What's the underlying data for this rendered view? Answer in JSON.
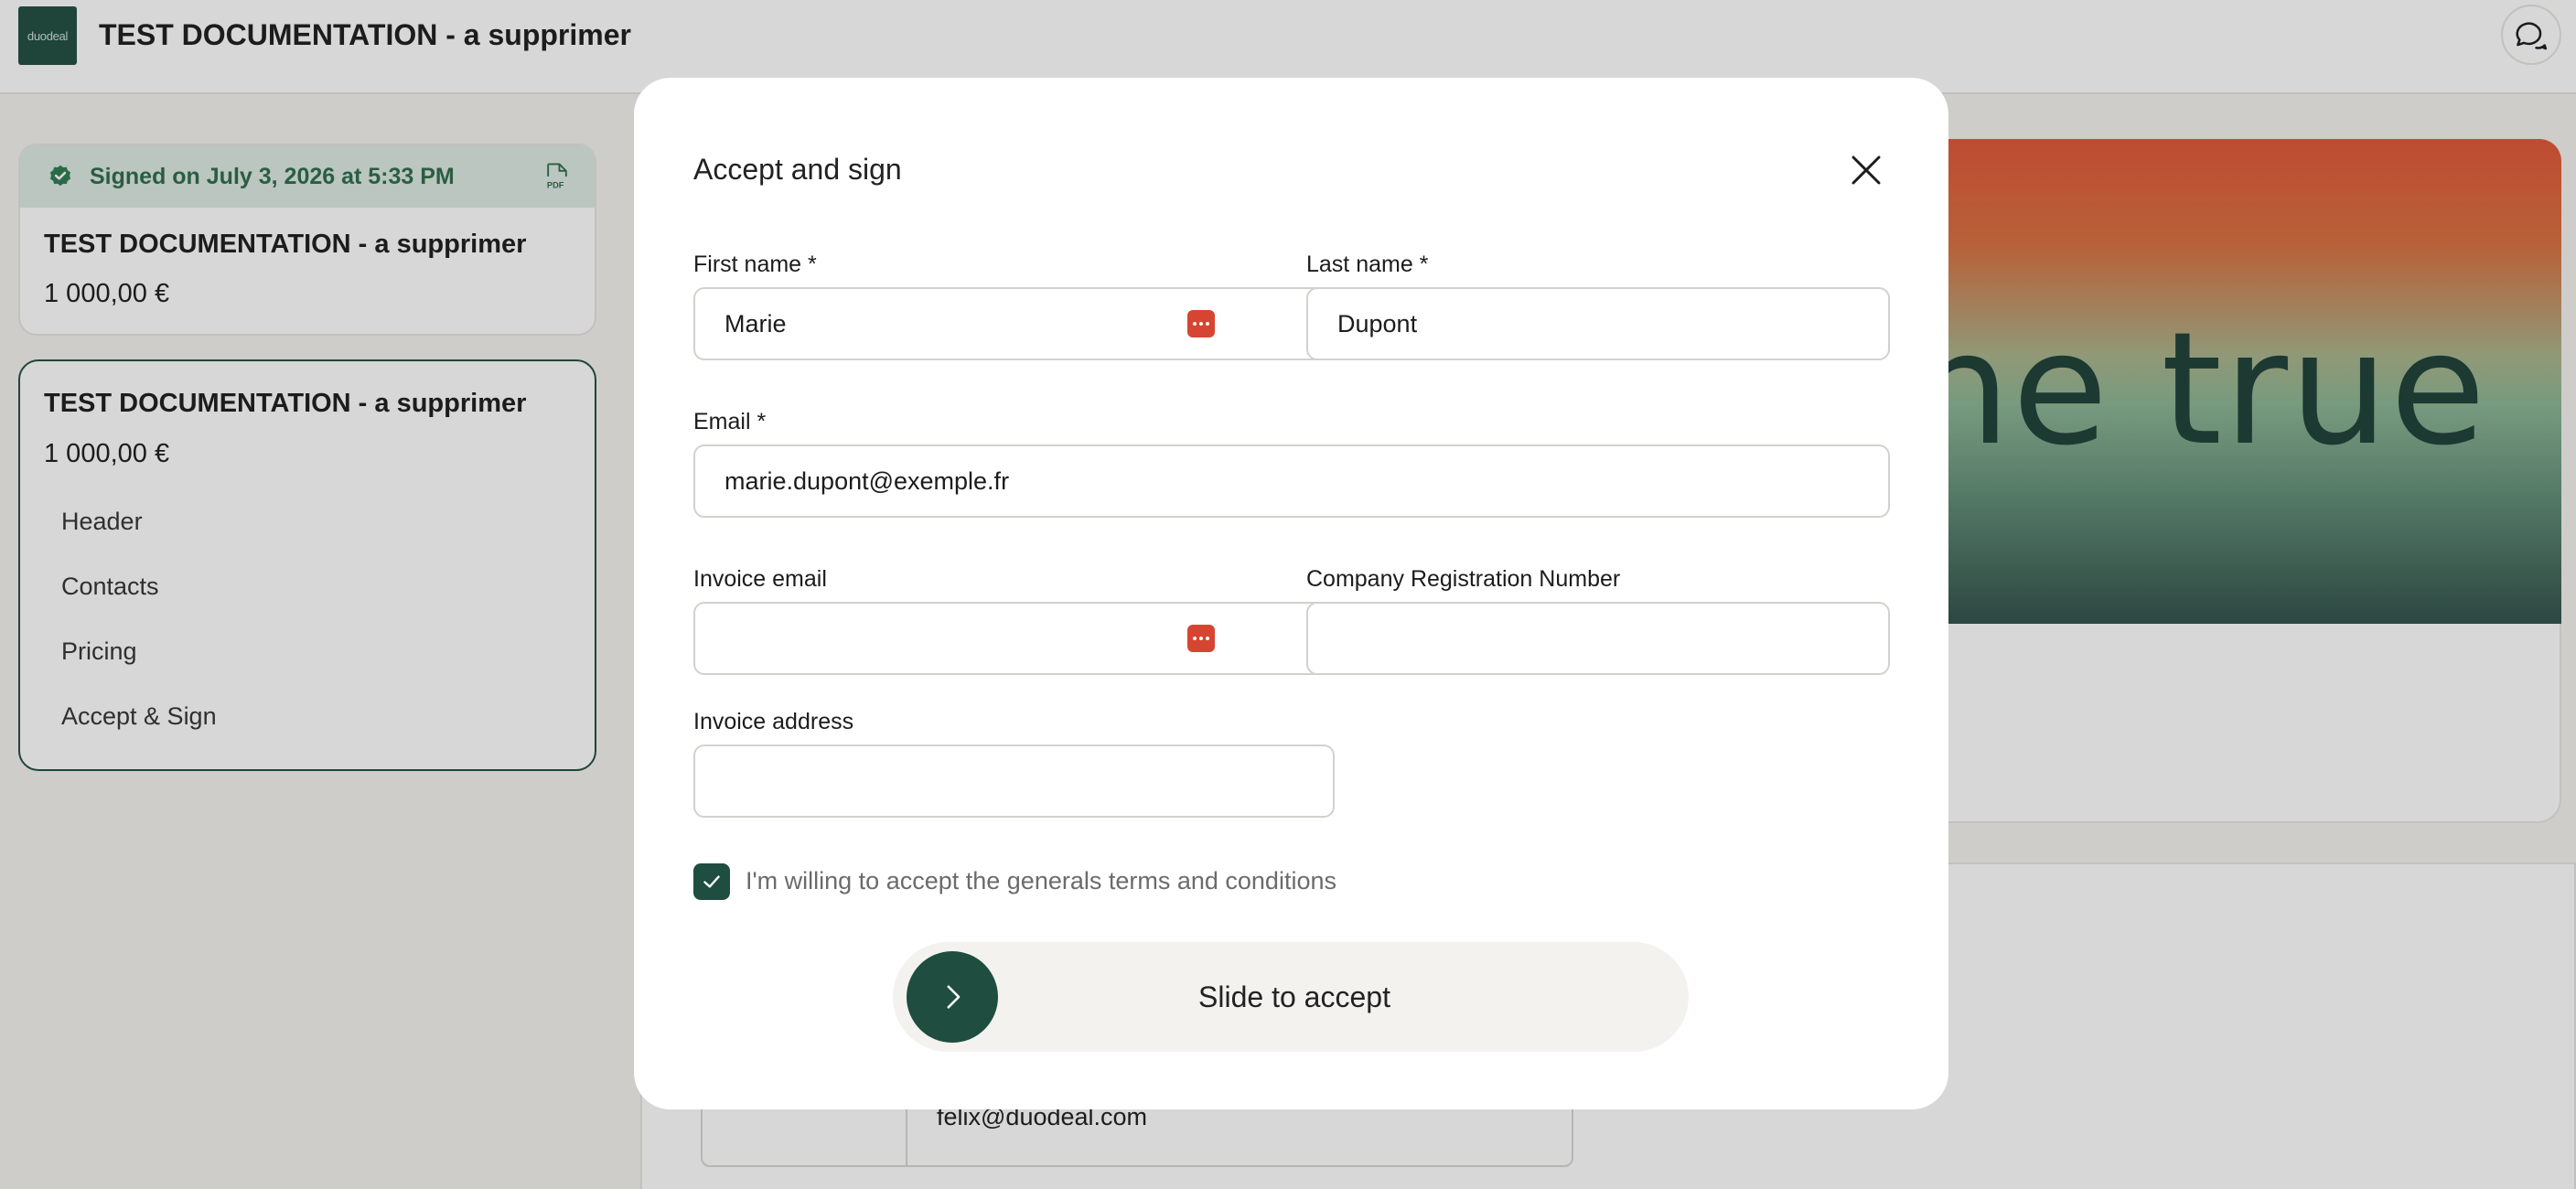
{
  "header": {
    "logo_text": "duodeal",
    "title": "TEST DOCUMENTATION - a supprimer",
    "chat_icon": "chat-bubbles-icon"
  },
  "sidebar": {
    "signed_card": {
      "status": "Signed on July 3, 2026 at 5:33 PM",
      "status_icon": "check-badge-icon",
      "pdf_icon": "pdf-file-icon",
      "title": "TEST DOCUMENTATION - a supprimer",
      "amount": "1 000,00 €"
    },
    "active_card": {
      "title": "TEST DOCUMENTATION - a supprimer",
      "amount": "1 000,00 €",
      "items": [
        {
          "label": "Header"
        },
        {
          "label": "Contacts"
        },
        {
          "label": "Pricing"
        },
        {
          "label": "Accept & Sign"
        }
      ]
    }
  },
  "document": {
    "hero_text": "he true",
    "contact_email": "felix@duodeal.com"
  },
  "modal": {
    "title": "Accept and sign",
    "close_icon": "close-icon",
    "fields": {
      "first_name": {
        "label": "First name *",
        "value": "Marie"
      },
      "last_name": {
        "label": "Last name *",
        "value": "Dupont"
      },
      "email": {
        "label": "Email *",
        "value": "marie.dupont@exemple.fr"
      },
      "invoice_email": {
        "label": "Invoice email",
        "value": ""
      },
      "company_reg": {
        "label": "Company Registration Number",
        "value": ""
      },
      "invoice_address": {
        "label": "Invoice address",
        "value": ""
      }
    },
    "terms": {
      "label": "I'm willing to accept the generals terms and conditions",
      "checked": true
    },
    "slider": {
      "label": "Slide to accept",
      "icon": "chevron-right-icon"
    }
  },
  "colors": {
    "brand": "#1f4d40",
    "signed_green": "#2d6b4a",
    "password_badge": "#d64531"
  }
}
